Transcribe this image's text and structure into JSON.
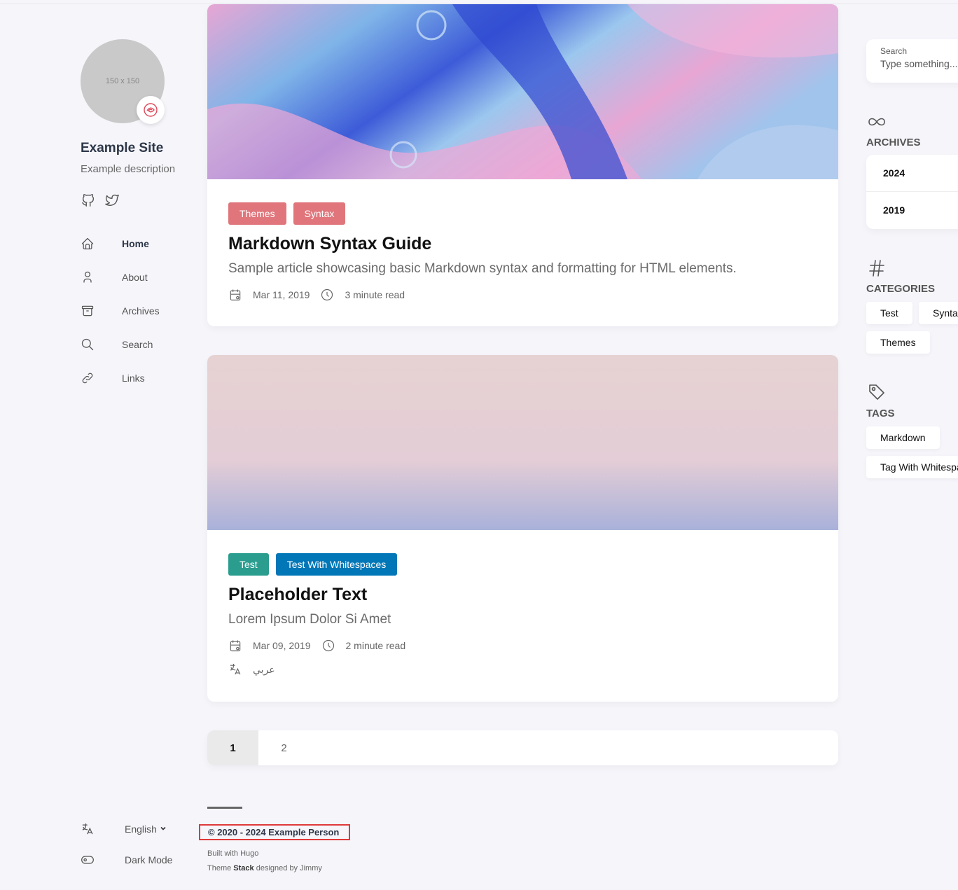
{
  "sidebar": {
    "avatar_placeholder": "150 x 150",
    "site_name": "Example Site",
    "site_description": "Example description",
    "social": [
      {
        "icon": "github-icon"
      },
      {
        "icon": "twitter-icon"
      }
    ],
    "menu": [
      {
        "label": "Home",
        "icon": "home-icon",
        "active": true
      },
      {
        "label": "About",
        "icon": "user-icon"
      },
      {
        "label": "Archives",
        "icon": "archive-icon"
      },
      {
        "label": "Search",
        "icon": "search-icon"
      },
      {
        "label": "Links",
        "icon": "link-icon"
      }
    ],
    "language": "English",
    "dark_mode": "Dark Mode"
  },
  "articles": [
    {
      "tags": [
        {
          "label": "Themes",
          "color": "#e0767c"
        },
        {
          "label": "Syntax",
          "color": "#e0767c"
        }
      ],
      "title": "Markdown Syntax Guide",
      "subtitle": "Sample article showcasing basic Markdown syntax and formatting for HTML elements.",
      "date": "Mar 11, 2019",
      "read_time": "3 minute read"
    },
    {
      "tags": [
        {
          "label": "Test",
          "color": "#2a9d8f"
        },
        {
          "label": "Test With Whitespaces",
          "color": "#0177b8"
        }
      ],
      "title": "Placeholder Text",
      "subtitle": "Lorem Ipsum Dolor Si Amet",
      "date": "Mar 09, 2019",
      "read_time": "2 minute read",
      "translation": "عربي"
    }
  ],
  "pagination": {
    "pages": [
      "1",
      "2"
    ],
    "current": "1"
  },
  "footer": {
    "copyright": "© 2020 - 2024 Example Person",
    "built_with_prefix": "Built with ",
    "built_with": "Hugo",
    "theme_prefix": "Theme ",
    "theme_name": "Stack",
    "theme_suffix": " designed by ",
    "theme_author": "Jimmy"
  },
  "right": {
    "search_label": "Search",
    "search_placeholder": "Type something...",
    "archives_title": "ARCHIVES",
    "archives": [
      "2024",
      "2019"
    ],
    "categories_title": "CATEGORIES",
    "categories": [
      "Test",
      "Syntax",
      "Themes"
    ],
    "tags_title": "TAGS",
    "tags": [
      "Markdown",
      "Tag With Whitespace"
    ]
  }
}
